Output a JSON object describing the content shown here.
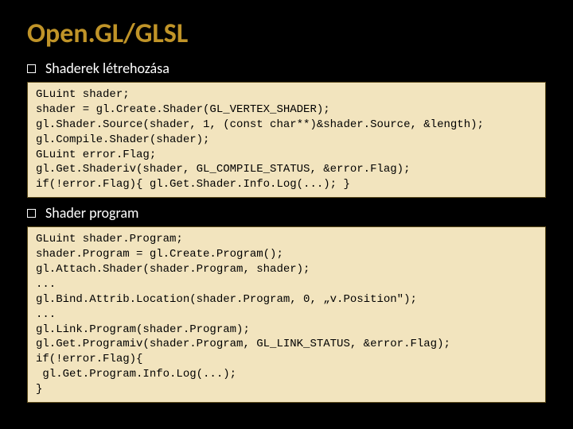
{
  "title": "Open.GL/GLSL",
  "sections": [
    {
      "heading": "Shaderek létrehozása",
      "code": "GLuint shader;\nshader = gl.Create.Shader(GL_VERTEX_SHADER);\ngl.Shader.Source(shader, 1, (const char**)&shader.Source, &length);\ngl.Compile.Shader(shader);\nGLuint error.Flag;\ngl.Get.Shaderiv(shader, GL_COMPILE_STATUS, &error.Flag);\nif(!error.Flag){ gl.Get.Shader.Info.Log(...); }"
    },
    {
      "heading": "Shader program",
      "code": "GLuint shader.Program;\nshader.Program = gl.Create.Program();\ngl.Attach.Shader(shader.Program, shader);\n...\ngl.Bind.Attrib.Location(shader.Program, 0, „v.Position\");\n...\ngl.Link.Program(shader.Program);\ngl.Get.Programiv(shader.Program, GL_LINK_STATUS, &error.Flag);\nif(!error.Flag){\n gl.Get.Program.Info.Log(...);\n}"
    }
  ]
}
